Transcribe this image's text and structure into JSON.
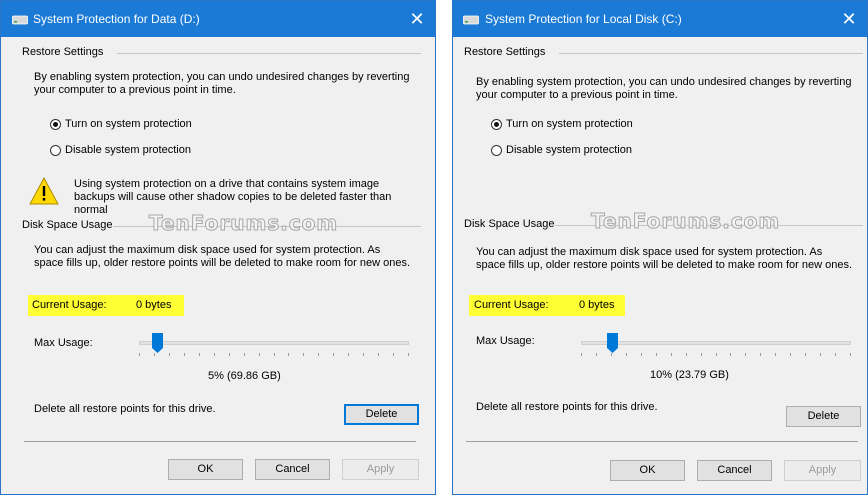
{
  "dialog_left": {
    "title": "System Protection for Data (D:)",
    "close_glyph": "✕",
    "restore_settings_label": "Restore Settings",
    "intro_text": "By enabling system protection, you can undo undesired changes by reverting your computer to a previous point in time.",
    "radio_on_label": "Turn on system protection",
    "radio_off_label": "Disable system protection",
    "selected_option": "on",
    "warning_text": "Using system protection on a drive that contains system image backups will cause other shadow copies to be deleted faster than normal",
    "disk_space_label": "Disk Space Usage",
    "watermark": "TenForums.com",
    "disk_text": "You can adjust the maximum disk space used for system protection. As space fills up, older restore points will be deleted to make room for new ones.",
    "current_usage_label": "Current Usage:",
    "current_usage_value": "0 bytes",
    "max_usage_label": "Max Usage:",
    "max_usage_percent": 5,
    "max_usage_value": "5% (69.86 GB)",
    "delete_text": "Delete all restore points for this drive.",
    "delete_button": "Delete",
    "ok_button": "OK",
    "cancel_button": "Cancel",
    "apply_button": "Apply",
    "accent_color": "#1a7ad6",
    "highlight_color": "#ffff33"
  },
  "dialog_right": {
    "title": "System Protection for Local Disk (C:)",
    "close_glyph": "✕",
    "restore_settings_label": "Restore Settings",
    "intro_text": "By enabling system protection, you can undo undesired changes by reverting your computer to a previous point in time.",
    "radio_on_label": "Turn on system protection",
    "radio_off_label": "Disable system protection",
    "selected_option": "on",
    "disk_space_label": "Disk Space Usage",
    "watermark": "TenForums.com",
    "disk_text": "You can adjust the maximum disk space used for system protection. As space fills up, older restore points will be deleted to make room for new ones.",
    "current_usage_label": "Current Usage:",
    "current_usage_value": "0 bytes",
    "max_usage_label": "Max Usage:",
    "max_usage_percent": 10,
    "max_usage_value": "10% (23.79 GB)",
    "delete_text": "Delete all restore points for this drive.",
    "delete_button": "Delete",
    "ok_button": "OK",
    "cancel_button": "Cancel",
    "apply_button": "Apply",
    "accent_color": "#1a7ad6",
    "highlight_color": "#ffff33"
  }
}
